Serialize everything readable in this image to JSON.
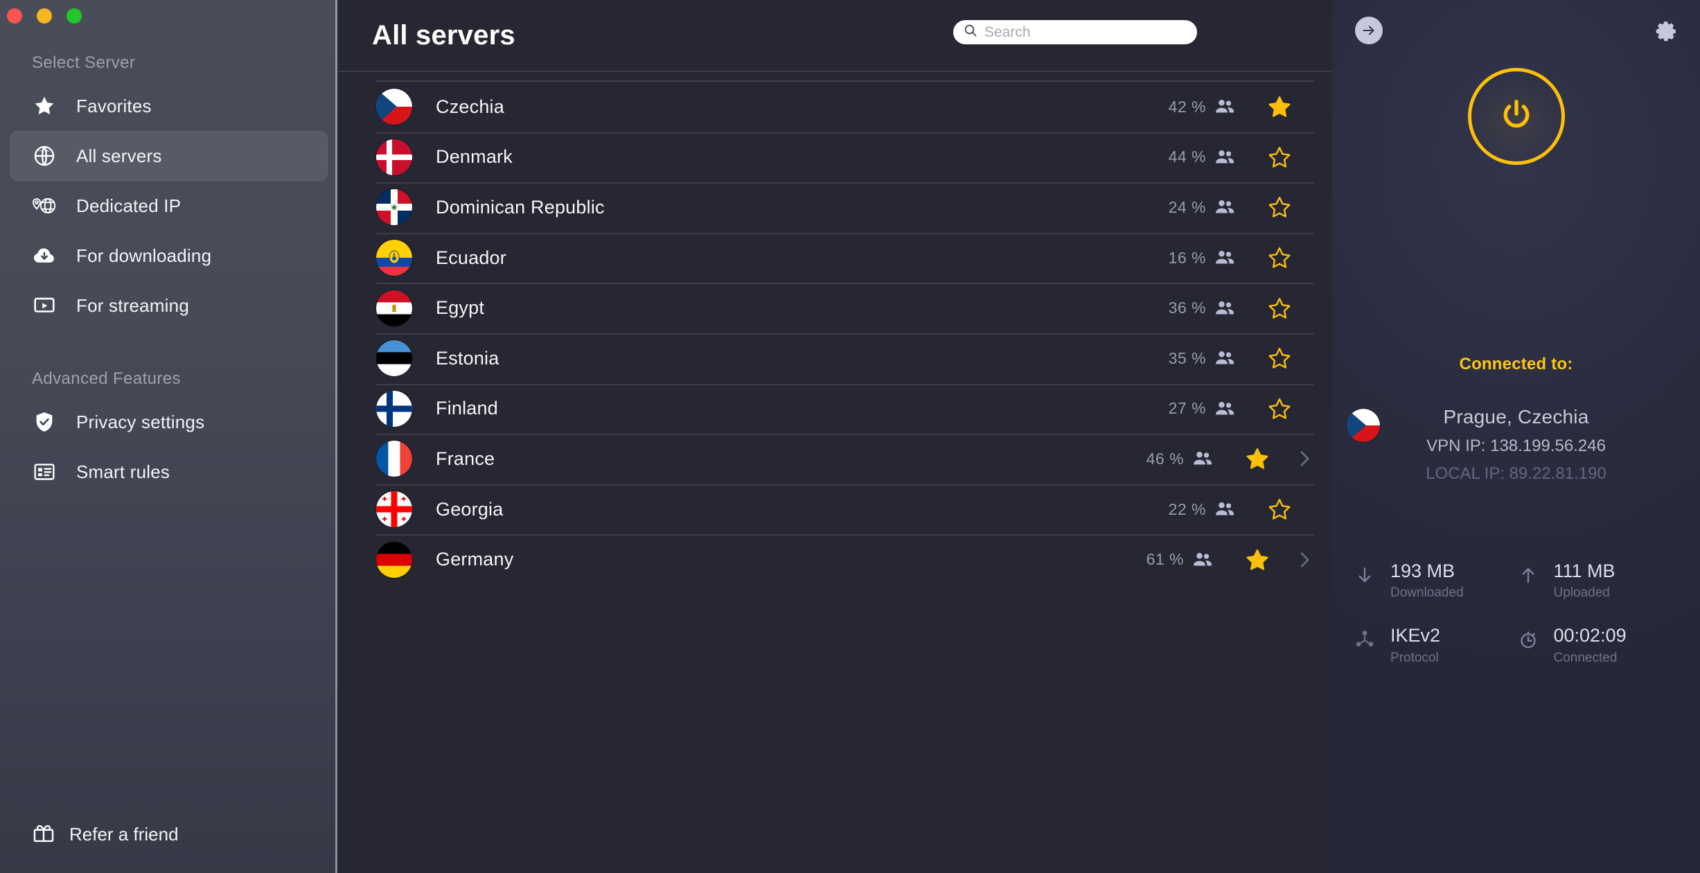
{
  "window": {
    "traffic_lights": [
      "close",
      "minimize",
      "maximize"
    ]
  },
  "sidebar": {
    "section_select_server": "Select Server",
    "section_advanced": "Advanced Features",
    "items": [
      {
        "label": "Favorites",
        "icon": "star-icon",
        "active": false
      },
      {
        "label": "All servers",
        "icon": "globe-icon",
        "active": true
      },
      {
        "label": "Dedicated IP",
        "icon": "dedicated-ip-icon",
        "active": false
      },
      {
        "label": "For downloading",
        "icon": "cloud-download-icon",
        "active": false
      },
      {
        "label": "For streaming",
        "icon": "video-play-icon",
        "active": false
      }
    ],
    "advanced_items": [
      {
        "label": "Privacy settings",
        "icon": "shield-check-icon"
      },
      {
        "label": "Smart rules",
        "icon": "list-rules-icon"
      }
    ],
    "refer": {
      "label": "Refer a friend",
      "icon": "gift-icon"
    }
  },
  "main": {
    "title": "All servers",
    "search": {
      "placeholder": "Search",
      "value": "",
      "icon": "search-icon"
    },
    "servers": [
      {
        "country": "Czechia",
        "load": "42 %",
        "favorite": true,
        "expandable": false,
        "flag": "cz"
      },
      {
        "country": "Denmark",
        "load": "44 %",
        "favorite": false,
        "expandable": false,
        "flag": "dk"
      },
      {
        "country": "Dominican Republic",
        "load": "24 %",
        "favorite": false,
        "expandable": false,
        "flag": "do"
      },
      {
        "country": "Ecuador",
        "load": "16 %",
        "favorite": false,
        "expandable": false,
        "flag": "ec"
      },
      {
        "country": "Egypt",
        "load": "36 %",
        "favorite": false,
        "expandable": false,
        "flag": "eg"
      },
      {
        "country": "Estonia",
        "load": "35 %",
        "favorite": false,
        "expandable": false,
        "flag": "ee"
      },
      {
        "country": "Finland",
        "load": "27 %",
        "favorite": false,
        "expandable": false,
        "flag": "fi"
      },
      {
        "country": "France",
        "load": "46 %",
        "favorite": true,
        "expandable": true,
        "flag": "fr"
      },
      {
        "country": "Georgia",
        "load": "22 %",
        "favorite": false,
        "expandable": false,
        "flag": "ge"
      },
      {
        "country": "Germany",
        "load": "61 %",
        "favorite": true,
        "expandable": true,
        "flag": "de"
      }
    ]
  },
  "panel": {
    "collapse_icon": "arrow-right-icon",
    "settings_icon": "gear-icon",
    "power_icon": "power-icon",
    "connected_label": "Connected to:",
    "location": "Prague, Czechia",
    "vpn_ip": "VPN IP: 138.199.56.246",
    "local_ip": "LOCAL IP: 89.22.81.190",
    "stats": [
      {
        "value": "193 MB",
        "caption": "Downloaded",
        "icon": "arrow-down-icon"
      },
      {
        "value": "111 MB",
        "caption": "Uploaded",
        "icon": "arrow-up-icon"
      },
      {
        "value": "IKEv2",
        "caption": "Protocol",
        "icon": "protocol-node-icon"
      },
      {
        "value": "00:02:09",
        "caption": "Connected",
        "icon": "stopwatch-icon"
      }
    ]
  },
  "colors": {
    "accent_yellow": "#fcc00a",
    "sidebar_bg": "#474b57",
    "main_bg": "#272734",
    "panel_bg": "#262838"
  }
}
